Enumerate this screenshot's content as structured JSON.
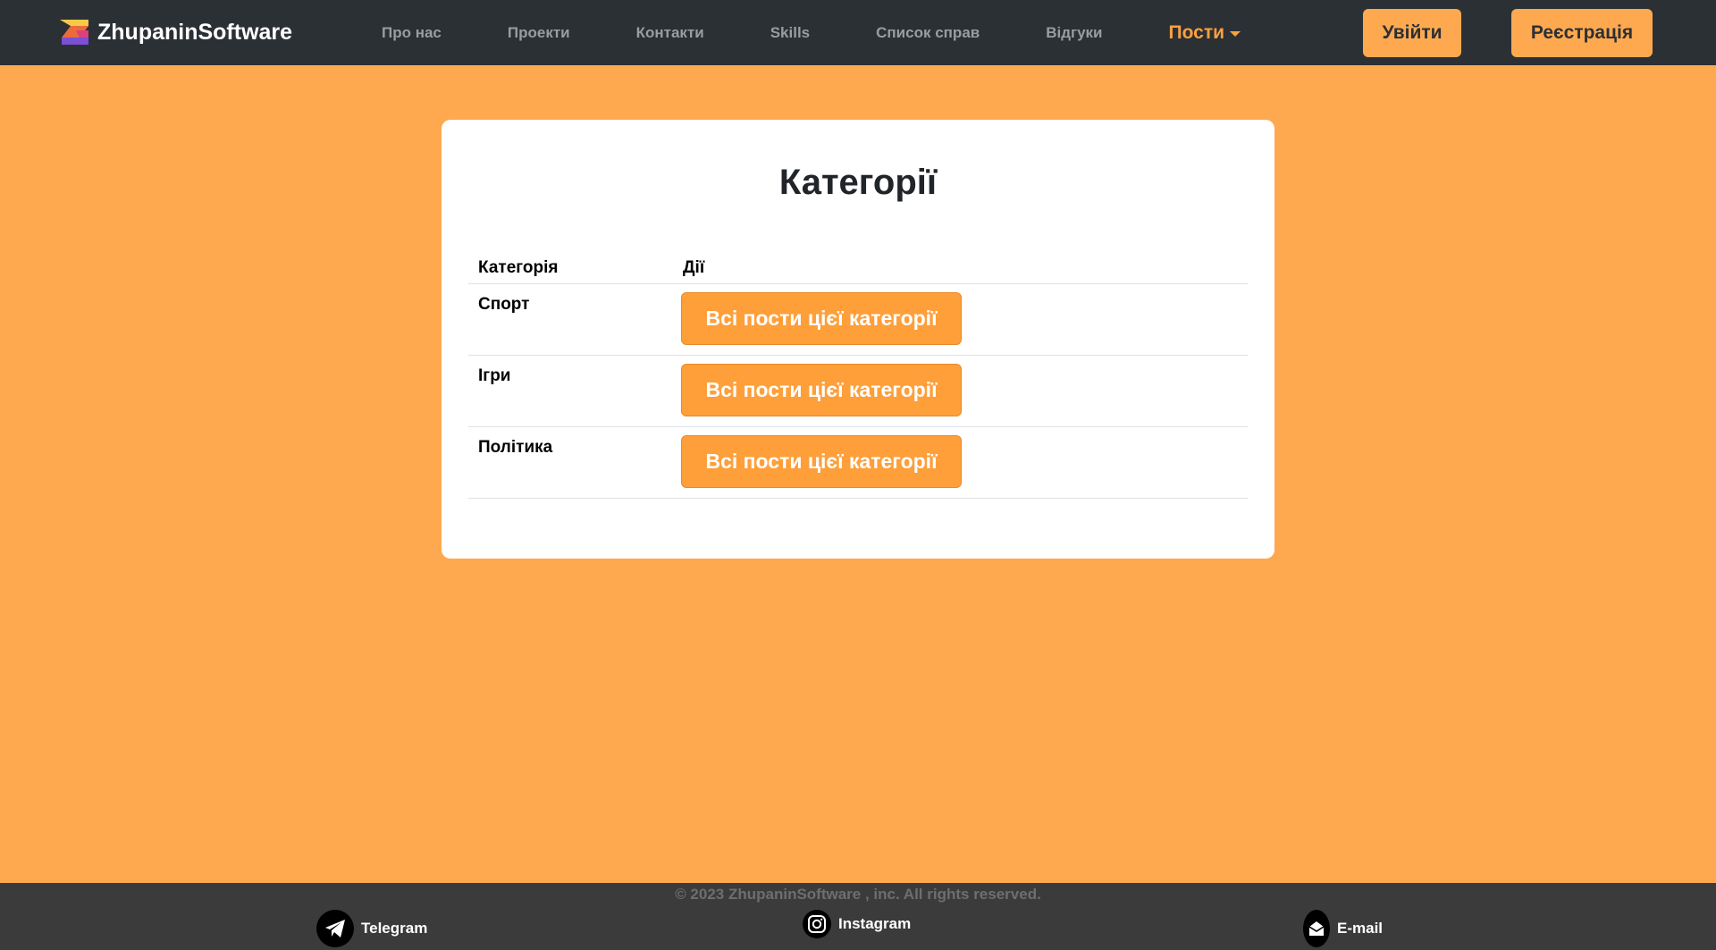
{
  "brand": {
    "name": "ZhupaninSoftware"
  },
  "nav": {
    "items": [
      {
        "label": "Про нас"
      },
      {
        "label": "Проекти"
      },
      {
        "label": "Контакти"
      },
      {
        "label": "Skills"
      },
      {
        "label": "Список справ"
      },
      {
        "label": "Відгуки"
      }
    ],
    "active_dropdown": "Пости",
    "login_label": "Увійти",
    "register_label": "Реєстрація"
  },
  "page": {
    "title": "Категорії",
    "table": {
      "headers": [
        "Категорія",
        "Дії"
      ],
      "rows": [
        {
          "category": "Спорт",
          "action_label": "Всі пости цієї категорії"
        },
        {
          "category": "Ігри",
          "action_label": "Всі пости цієї категорії"
        },
        {
          "category": "Політика",
          "action_label": "Всі пости цієї категорії"
        }
      ]
    }
  },
  "footer": {
    "copyright": "© 2023 ZhupaninSoftware , inc. All rights reserved.",
    "links": [
      {
        "label": "Telegram",
        "icon": "telegram-icon"
      },
      {
        "label": "Instagram",
        "icon": "instagram-icon"
      },
      {
        "label": "E-mail",
        "icon": "email-icon"
      }
    ]
  },
  "colors": {
    "page_bg": "#FEA94F",
    "navbar_bg": "#2B3035",
    "accent": "#FE9F3A",
    "footer_bg": "#3B3B3B"
  }
}
